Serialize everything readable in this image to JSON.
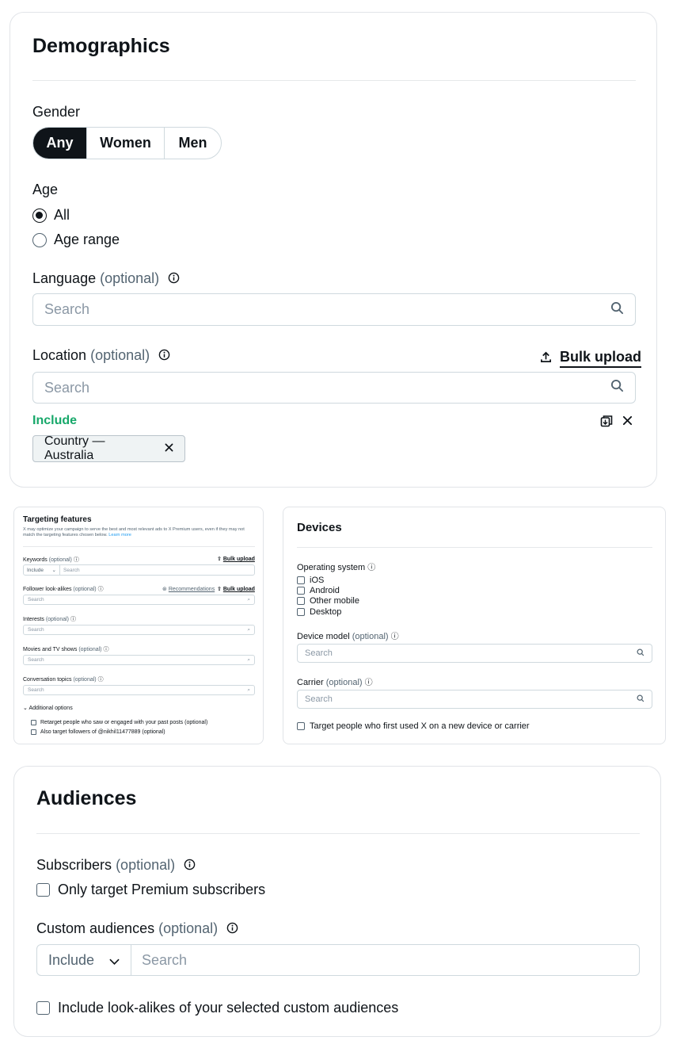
{
  "demographics": {
    "title": "Demographics",
    "gender": {
      "label": "Gender",
      "options": [
        "Any",
        "Women",
        "Men"
      ],
      "selected": "Any"
    },
    "age": {
      "label": "Age",
      "options": [
        "All",
        "Age range"
      ],
      "selected": "All"
    },
    "language": {
      "label": "Language",
      "optional": "(optional)",
      "placeholder": "Search"
    },
    "location": {
      "label": "Location",
      "optional": "(optional)",
      "bulk_upload": "Bulk upload",
      "placeholder": "Search",
      "include_label": "Include",
      "chips": [
        "Country — Australia"
      ]
    }
  },
  "targeting_features": {
    "title": "Targeting features",
    "description": "X may optimize your campaign to serve the best and most relevant ads to X Premium users, even if they may not match the targeting features chosen below.",
    "learn_more": "Learn more",
    "keywords": {
      "label": "Keywords",
      "optional": "(optional)",
      "bulk_upload": "Bulk upload",
      "include": "Include",
      "placeholder": "Search"
    },
    "follower_lookalikes": {
      "label": "Follower look-alikes",
      "optional": "(optional)",
      "recommendations": "Recommendations",
      "bulk_upload": "Bulk upload",
      "placeholder": "Search"
    },
    "interests": {
      "label": "Interests",
      "optional": "(optional)",
      "placeholder": "Search"
    },
    "movies_tv": {
      "label": "Movies and TV shows",
      "optional": "(optional)",
      "placeholder": "Search"
    },
    "conversation_topics": {
      "label": "Conversation topics",
      "optional": "(optional)",
      "placeholder": "Search"
    },
    "additional_options": "Additional options",
    "checkboxes": [
      "Retarget people who saw or engaged with your past posts (optional)",
      "Also target followers of @nikhil11477889 (optional)"
    ]
  },
  "devices": {
    "title": "Devices",
    "os": {
      "label": "Operating system",
      "options": [
        "iOS",
        "Android",
        "Other mobile",
        "Desktop"
      ]
    },
    "device_model": {
      "label": "Device model",
      "optional": "(optional)",
      "placeholder": "Search"
    },
    "carrier": {
      "label": "Carrier",
      "optional": "(optional)",
      "placeholder": "Search"
    },
    "new_device_checkbox": "Target people who first used X on a new device or carrier"
  },
  "audiences": {
    "title": "Audiences",
    "subscribers": {
      "label": "Subscribers",
      "optional": "(optional)",
      "checkbox": "Only target Premium subscribers"
    },
    "custom": {
      "label": "Custom audiences",
      "optional": "(optional)",
      "include": "Include",
      "placeholder": "Search"
    },
    "lookalikes_checkbox": "Include look-alikes of your selected custom audiences"
  },
  "colors": {
    "include_green": "#17a86a",
    "primary_dark": "#0f1419",
    "muted": "#536471",
    "learn_more_blue": "#1d9bf0"
  }
}
